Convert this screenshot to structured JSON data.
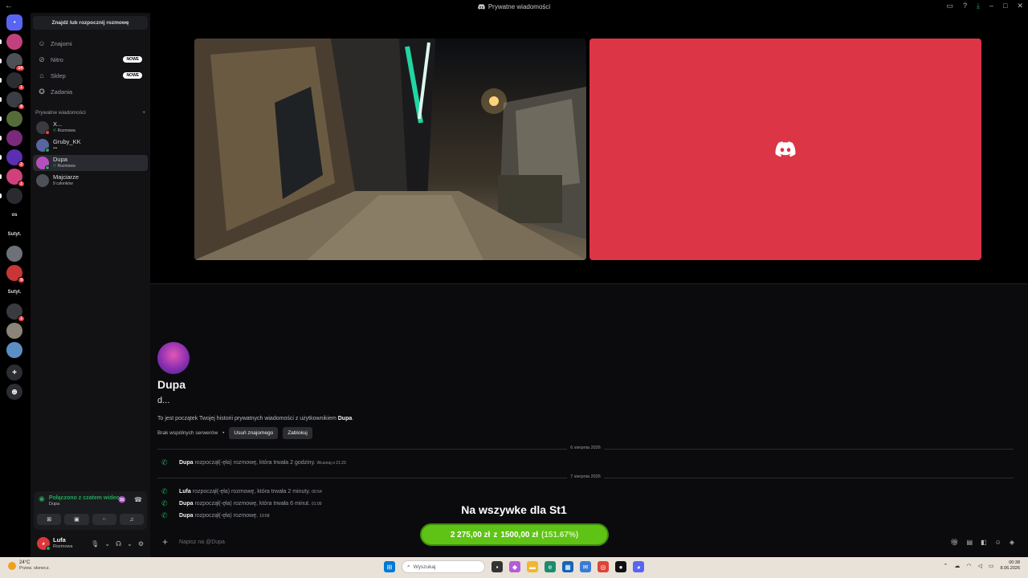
{
  "window": {
    "title": "Prywatne wiadomości",
    "controls": [
      "inbox-icon",
      "help-icon",
      "download-icon",
      "minimize",
      "maximize",
      "close"
    ]
  },
  "guilds": [
    {
      "kind": "home",
      "icon": "discord-logo"
    },
    {
      "kind": "server",
      "badge": ""
    },
    {
      "kind": "server",
      "badge": "14"
    },
    {
      "kind": "server",
      "badge": "1"
    },
    {
      "kind": "server",
      "badge": "8"
    },
    {
      "kind": "server",
      "badge": ""
    },
    {
      "kind": "server",
      "badge": ""
    },
    {
      "kind": "server",
      "badge": "2"
    },
    {
      "kind": "server",
      "badge": "1"
    },
    {
      "kind": "server",
      "badge": ""
    },
    {
      "kind": "text",
      "label": "os"
    },
    {
      "kind": "text",
      "label": "Sutyt."
    },
    {
      "kind": "server",
      "badge": ""
    },
    {
      "kind": "server",
      "badge": "9"
    },
    {
      "kind": "text",
      "label": "Sutyt."
    },
    {
      "kind": "server",
      "badge": "1"
    },
    {
      "kind": "server",
      "badge": ""
    },
    {
      "kind": "server",
      "badge": ""
    },
    {
      "kind": "add",
      "icon": "plus-icon"
    },
    {
      "kind": "discover",
      "icon": "compass-icon"
    }
  ],
  "sidebar": {
    "search_label": "Znajdź lub rozpocznij rozmowę",
    "nav": [
      {
        "label": "Znajomi",
        "icon": "friends-icon",
        "badge": ""
      },
      {
        "label": "Nitro",
        "icon": "nitro-icon",
        "badge": "NOWE"
      },
      {
        "label": "Sklep",
        "icon": "shop-icon",
        "badge": "NOWE"
      },
      {
        "label": "Zadania",
        "icon": "quests-icon",
        "badge": ""
      }
    ],
    "dm_header": "Prywatne wiadomości",
    "dm_add": "+",
    "dms": [
      {
        "name": "X...",
        "sub": "Rozmowa",
        "status": "#f23f43",
        "avatar": "#3a3b40",
        "active": false
      },
      {
        "name": "Gruby_KK",
        "sub": "•••",
        "status": "#23a55a",
        "avatar": "#5865a0",
        "active": false
      },
      {
        "name": "Dupa",
        "sub": "Rozmowa",
        "status": "#23a55a",
        "avatar": "#b54fbf",
        "active": true
      },
      {
        "name": "Majciarze",
        "sub": "9 członków",
        "status": "",
        "avatar": "#4e5058",
        "active": false
      }
    ]
  },
  "voice": {
    "status": "Połączono z czatem wideo",
    "channel": "Dupa",
    "buttons": [
      "camera-off-icon",
      "screen-share-icon",
      "activities-icon",
      "soundboard-icon"
    ]
  },
  "user": {
    "name": "Lufa",
    "status": "Rozmowa"
  },
  "profile": {
    "name": "Dupa",
    "handle": "d...",
    "intro_prefix": "To jest początek Twojej historii prywatnych wiadomości z użytkownikiem ",
    "intro_name": "Dupa",
    "intro_suffix": ".",
    "no_servers": "Brak wspólnych serwerów",
    "remove_friend": "Usuń znajomego",
    "block": "Zablokuj"
  },
  "messages": {
    "date1": "6 sierpnia 2026",
    "date2": "7 sierpnia 2026",
    "items": [
      {
        "author": "Dupa",
        "text": "rozpoczął(-ęła) rozmowę, która trwała 2 godziny.",
        "time": "Wczoraj o 21:23"
      },
      {
        "author": "Lufa",
        "text": "rozpoczął(-ęła) rozmowę, która trwała 2 minuty.",
        "time": "00:54"
      },
      {
        "author": "Dupa",
        "text": "rozpoczął(-ęła) rozmowę, która trwała 6 minut.",
        "time": "01:09"
      },
      {
        "author": "Dupa",
        "text": "rozpoczął(-ęła) rozmowę.",
        "time": "19:58"
      }
    ]
  },
  "composer": {
    "placeholder": "Napisz na @Dupa"
  },
  "overlay": {
    "title": "Na wszywke dla St1",
    "current": "2 275,00 zł",
    "separator": "z",
    "goal": "1500,00 zł",
    "percent": "(151.67%)",
    "percent_value": 151.67
  },
  "taskbar": {
    "temp": "24°C",
    "weather": "Przew. słonecz.",
    "search_placeholder": "Wyszukaj",
    "time": "00:38",
    "date": "8.06.2026"
  },
  "colors": {
    "accent_red": "#dc3545",
    "online": "#23a55a",
    "goal_green": "#5fc316"
  }
}
